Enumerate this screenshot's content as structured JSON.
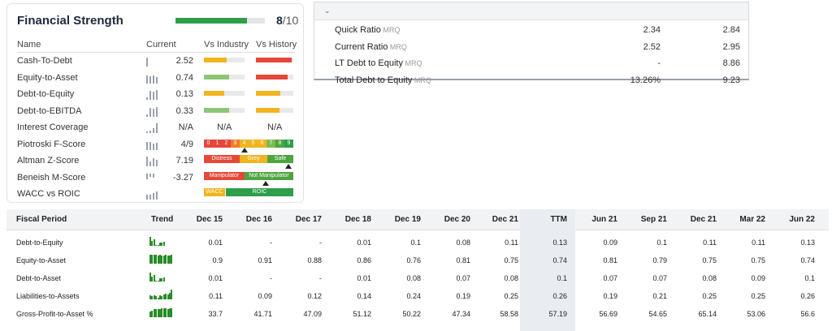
{
  "financial_strength": {
    "title": "Financial Strength",
    "score_value": "8",
    "score_denominator": "/10",
    "score_fraction": 0.8,
    "headers": {
      "name": "Name",
      "current": "Current",
      "vs_industry": "Vs Industry",
      "vs_history": "Vs History"
    },
    "rows": [
      {
        "name": "Cash-To-Debt",
        "value": "2.52",
        "industry": 0.55,
        "industry_color": "#f0b41e",
        "history": 0.95,
        "history_color": "#e5473a"
      },
      {
        "name": "Equity-to-Asset",
        "value": "0.74",
        "industry": 0.62,
        "industry_color": "#8cc677",
        "history": 0.85,
        "history_color": "#e5473a"
      },
      {
        "name": "Debt-to-Equity",
        "value": "0.13",
        "industry": 0.5,
        "industry_color": "#f0b41e",
        "history": 0.65,
        "history_color": "#f0b41e"
      },
      {
        "name": "Debt-to-EBITDA",
        "value": "0.33",
        "industry": 0.62,
        "industry_color": "#8cc677",
        "history": 0.62,
        "history_color": "#f0b41e"
      },
      {
        "name": "Interest Coverage",
        "value": "N/A",
        "industry_text": "N/A",
        "history_text": "N/A"
      },
      {
        "name": "Piotroski F-Score",
        "value": "4/9"
      },
      {
        "name": "Altman Z-Score",
        "value": "7.19"
      },
      {
        "name": "Beneish M-Score",
        "value": "-3.27"
      },
      {
        "name": "WACC vs ROIC",
        "value": ""
      }
    ],
    "piotroski": {
      "labels": [
        "0",
        "1",
        "2",
        "3",
        "4",
        "5",
        "6",
        "7",
        "8",
        "9"
      ],
      "score": 4
    },
    "altman": {
      "labels": [
        "Distress",
        "Grey",
        "Safe"
      ]
    },
    "beneish": {
      "labels": [
        "Manipulator",
        "Not Manipulator"
      ]
    },
    "wacc_roic": {
      "labels": [
        "WACC",
        "ROIC"
      ]
    }
  },
  "ratios": {
    "rows": [
      {
        "label": "Quick Ratio",
        "suffix": "MRQ",
        "v1": "2.34",
        "v2": "2.84"
      },
      {
        "label": "Current Ratio",
        "suffix": "MRQ",
        "v1": "2.52",
        "v2": "2.95"
      },
      {
        "label": "LT Debt to Equity",
        "suffix": "MRQ",
        "v1": "-",
        "v2": "8.86"
      },
      {
        "label": "Total Debt to Equity",
        "suffix": "MRQ",
        "v1": "13.26%",
        "v2": "9.23"
      }
    ]
  },
  "fiscal": {
    "header_label": "Fiscal Period",
    "header_trend": "Trend",
    "periods": [
      "Dec 15",
      "Dec 16",
      "Dec 17",
      "Dec 18",
      "Dec 19",
      "Dec 20",
      "Dec 21",
      "TTM",
      "Jun 21",
      "Sep 21",
      "Dec 21",
      "Mar 22",
      "Jun 22"
    ],
    "rows": [
      {
        "label": "Debt-to-Equity",
        "trend": [
          0.9,
          0.5,
          0.7,
          0.1,
          0.1,
          0.3,
          0.3,
          0.4
        ],
        "values": [
          "0.01",
          "-",
          "-",
          "0.01",
          "0.1",
          "0.08",
          "0.11",
          "0.13",
          "0.09",
          "0.1",
          "0.11",
          "0.11",
          "0.13"
        ]
      },
      {
        "label": "Equity-to-Asset",
        "trend": [
          0.95,
          0.95,
          0.95,
          0.9,
          0.85,
          0.9,
          0.85,
          0.85,
          0.9,
          0.85,
          0.85,
          0.9
        ],
        "values": [
          "0.9",
          "0.91",
          "0.88",
          "0.86",
          "0.76",
          "0.81",
          "0.75",
          "0.74",
          "0.81",
          "0.79",
          "0.75",
          "0.75",
          "0.74"
        ]
      },
      {
        "label": "Debt-to-Asset",
        "trend": [
          0.9,
          0.5,
          0.7,
          0.1,
          0.1,
          0.3,
          0.3,
          0.4
        ],
        "values": [
          "0.01",
          "-",
          "-",
          "0.01",
          "0.08",
          "0.07",
          "0.08",
          "0.1",
          "0.07",
          "0.07",
          "0.08",
          "0.09",
          "0.1"
        ]
      },
      {
        "label": "Liabilities-to-Assets",
        "trend": [
          0.4,
          0.3,
          0.4,
          0.3,
          0.2,
          0.4,
          0.3,
          0.5,
          0.6,
          0.5,
          0.7,
          1.0
        ],
        "values": [
          "0.11",
          "0.09",
          "0.12",
          "0.14",
          "0.24",
          "0.19",
          "0.25",
          "0.26",
          "0.19",
          "0.21",
          "0.25",
          "0.25",
          "0.26"
        ]
      },
      {
        "label": "Gross-Profit-to-Asset %",
        "trend": [
          0.6,
          0.7,
          0.8,
          0.85,
          0.85,
          0.8,
          0.95,
          0.95,
          0.9,
          0.85,
          0.95,
          0.9
        ],
        "values": [
          "33.7",
          "41.71",
          "47.09",
          "51.12",
          "50.22",
          "47.34",
          "58.58",
          "57.19",
          "56.69",
          "54.65",
          "65.14",
          "53.06",
          "56.6"
        ]
      }
    ]
  }
}
